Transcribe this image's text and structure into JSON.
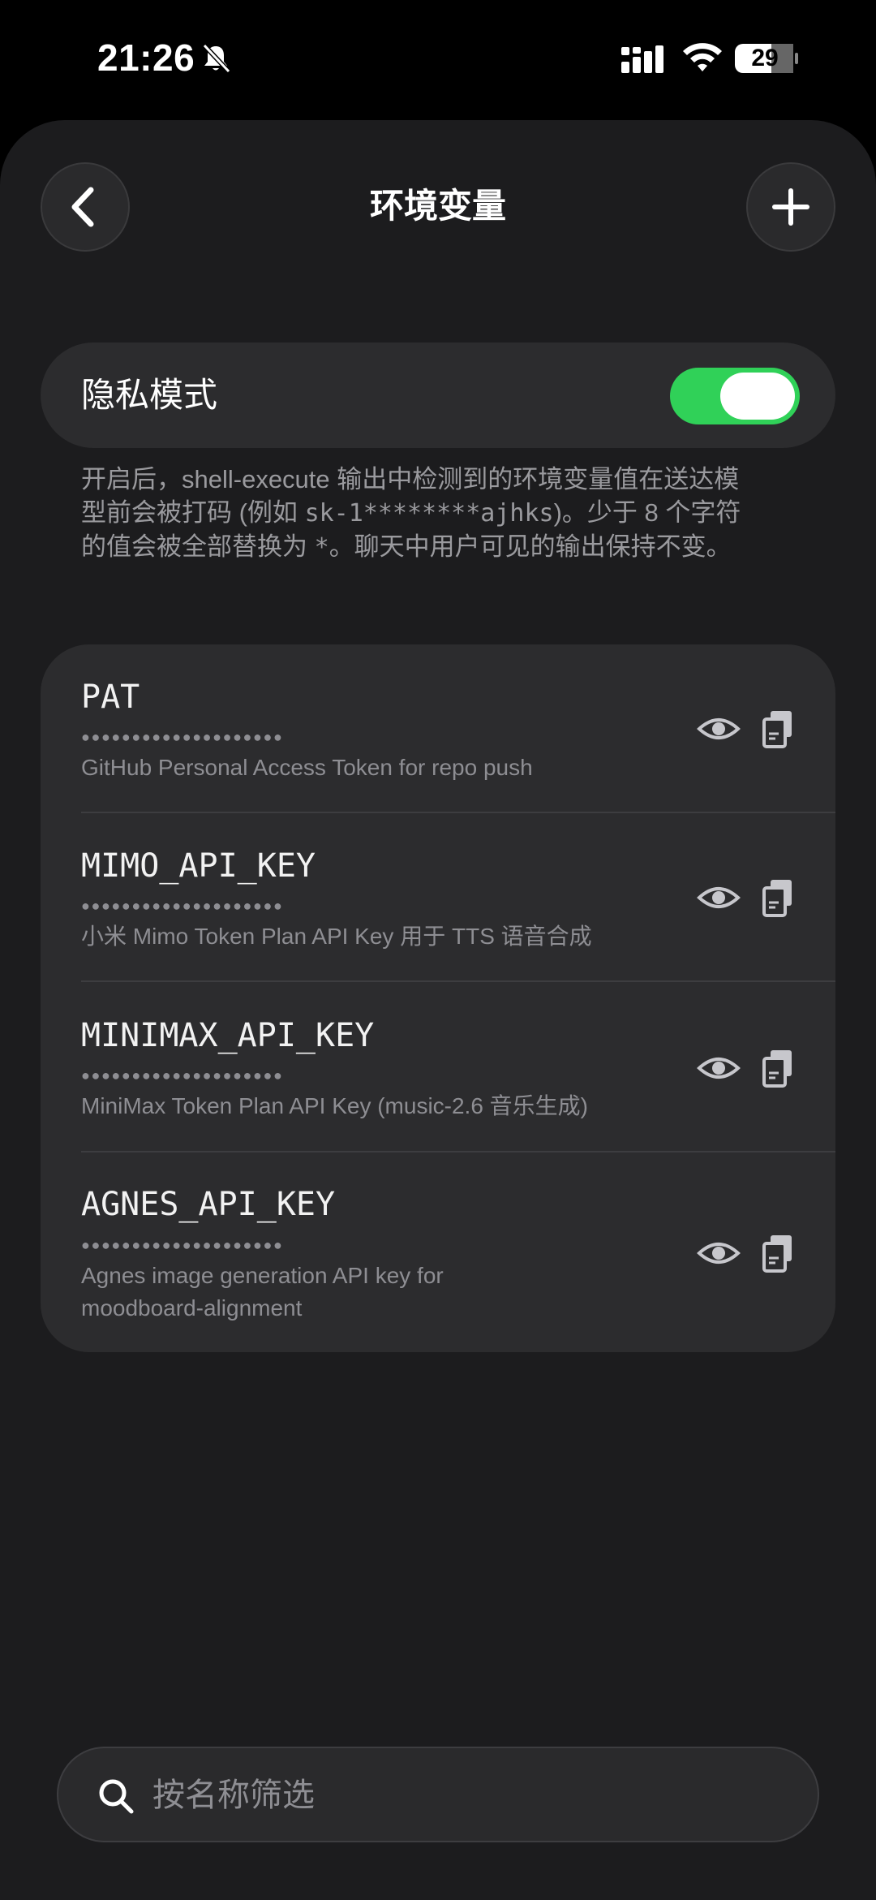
{
  "status_bar": {
    "time": "21:26",
    "battery": "29"
  },
  "header": {
    "title": "环境变量"
  },
  "privacy": {
    "label": "隐私模式",
    "enabled": true,
    "desc_part1": "开启后，shell-execute 输出中检测到的环境变量值在送达模型前会被打码 (例如 ",
    "desc_code1": "sk-1********ajhks",
    "desc_part2": ")。少于 8 个字符的值会被全部替换为 ",
    "desc_code2": "*",
    "desc_part3": "。聊天中用户可见的输出保持不变。"
  },
  "env_vars": [
    {
      "name": "PAT",
      "mask": "●●●●●●●●●●●●●●●●●●●●",
      "description": "GitHub Personal Access Token for repo push"
    },
    {
      "name": "MIMO_API_KEY",
      "mask": "●●●●●●●●●●●●●●●●●●●●",
      "description": "小米  Mimo Token Plan API Key 用于 TTS 语音合成"
    },
    {
      "name": "MINIMAX_API_KEY",
      "mask": "●●●●●●●●●●●●●●●●●●●●",
      "description": "MiniMax Token Plan API Key (music-2.6 音乐生成)"
    },
    {
      "name": "AGNES_API_KEY",
      "mask": "●●●●●●●●●●●●●●●●●●●●",
      "description": "Agnes image generation API key for moodboard-alignment"
    }
  ],
  "search": {
    "placeholder": "按名称筛选",
    "value": ""
  },
  "colors": {
    "background": "#1c1c1e",
    "card": "#2c2c2e",
    "toggle_on": "#30d158",
    "secondary_text": "#8e8e93"
  },
  "icons": [
    "bell-slash-icon",
    "signal-icon",
    "wifi-icon",
    "battery-icon",
    "chevron-left-icon",
    "plus-icon",
    "eye-icon",
    "copy-icon",
    "search-icon"
  ]
}
